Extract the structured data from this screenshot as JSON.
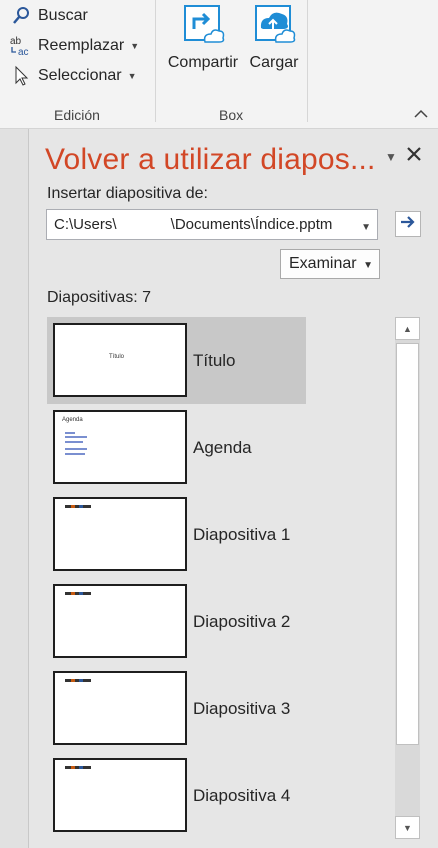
{
  "ribbon": {
    "edit_group": {
      "find": "Buscar",
      "replace": "Reemplazar",
      "select": "Seleccionar",
      "label": "Edición"
    },
    "box_group": {
      "share": "Compartir",
      "upload": "Cargar",
      "label": "Box"
    },
    "replace_icon_text": "ab→ac"
  },
  "pane": {
    "title": "Volver a utilizar diapos...",
    "insert_label": "Insertar diapositiva de:",
    "path_value": "C:\\Users\\             \\Documents\\Índice.pptm",
    "browse_label": "Examinar",
    "count_label": "Diapositivas: 7",
    "slides": [
      {
        "label": "Título",
        "mini": "Título"
      },
      {
        "label": "Agenda",
        "mini": "Agenda"
      },
      {
        "label": "Diapositiva 1"
      },
      {
        "label": "Diapositiva 2"
      },
      {
        "label": "Diapositiva 3"
      },
      {
        "label": "Diapositiva 4"
      }
    ],
    "selected_index": 0
  },
  "colors": {
    "title_accent": "#d24726",
    "selection": "#c8c8c8",
    "link_blue": "#2b579a",
    "box_blue": "#1f8dd6"
  }
}
